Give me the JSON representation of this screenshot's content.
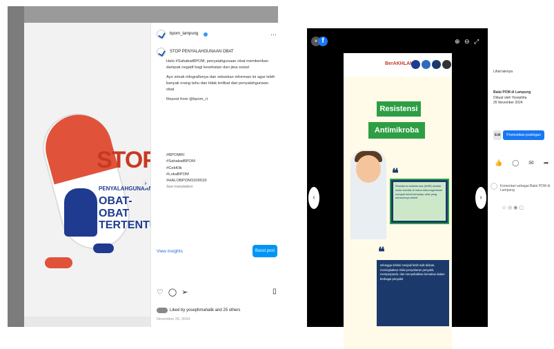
{
  "instagram": {
    "username": "bpom_lampung",
    "caption_title": "STOP PENYALAHGUNAAN OBAT",
    "caption_p1": "Halo #SahabatBPOM, penyalahgunaan obat memberikan dampak negatif bagi kesehatan dan jiwa sosial",
    "caption_p2": "Ayo simak infografisnya dan sebarkan informasi ini agar lebih banyak orang tahu dan tidak terlibat dari penyalahgunaan obat",
    "repost": "Repost from @bpom_ri",
    "hashtags": [
      "#BPOMRI",
      "#SahabatBPOM",
      "#CekKlik",
      "#LokaBPOM",
      "#HALOBPOM1500533"
    ],
    "see_translation": "See translation",
    "view_insights": "View insights",
    "boost_post": "Boost post",
    "liked_by": "Liked by yosephmahalik and 25 others",
    "date": "November 26, 2024",
    "poster_stop": "STOP",
    "poster_sub": "PENYALAHGUNAAN",
    "poster_big": "OBAT-OBAT TERTENTU"
  },
  "facebook": {
    "poster_brand": "BerAKHLAK",
    "poster_title1": "Resistensi",
    "poster_title2": "Antimikroba",
    "box1_text": "Resistensi antimikroba (AMR) adalah suatu kondisi di mana mikroorganisme menjadi kebal terhadap obat yang seharusnya efektif",
    "box2_text": "sehingga infeksi menjadi lebih sulit diobati, meningkatkan risiko penyebaran penyakit, memperparah, dan menyebabkan kematian dalam berbagai penyakit",
    "side_link": "Lihat lainnya",
    "side_page": "Balai POM di Lampung",
    "side_sub": "Dibuat oleh Yosephita",
    "side_date": "26 November 2024",
    "edit_label": "Edit",
    "promo_label": "Promosikan postingan",
    "comment_placeholder": "Komentari sebagai Balai POM di Lampung"
  },
  "colors": {
    "ig_boost": "#0095f6",
    "fb_blue": "#1877f2",
    "poster_green": "#2e9e44",
    "poster_navy": "#1b3a6b",
    "stop_red": "#c73a22"
  }
}
